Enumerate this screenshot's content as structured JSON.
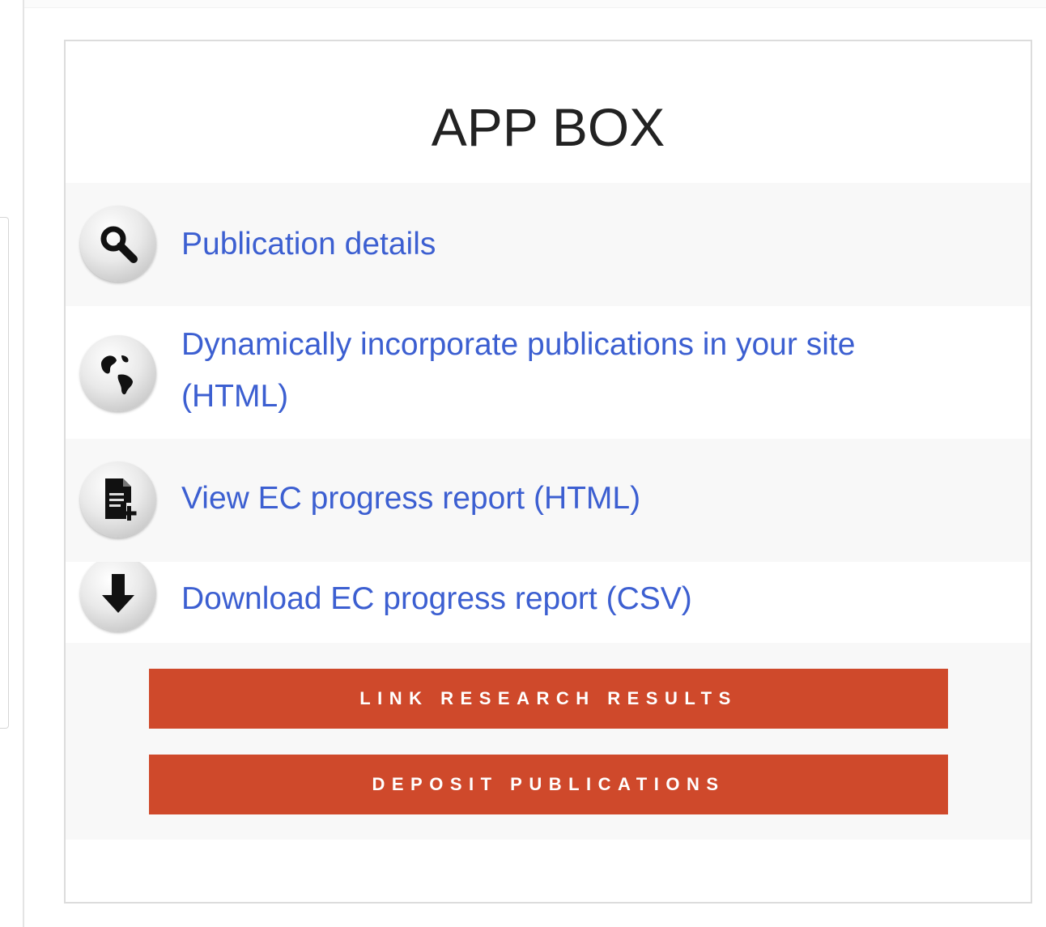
{
  "app_box": {
    "title": "APP BOX",
    "items": [
      {
        "label": "Publication details",
        "icon": "search-icon"
      },
      {
        "label": "Dynamically incorporate publications in your site",
        "label_line2": "(HTML)",
        "icon": "globe-icon"
      },
      {
        "label": "View EC progress report (HTML)",
        "icon": "document-add-icon"
      },
      {
        "label": "Download EC progress report (CSV)",
        "icon": "download-arrow-icon"
      }
    ],
    "buttons": {
      "link_research_results": "LINK RESEARCH RESULTS",
      "deposit_publications": "DEPOSIT PUBLICATIONS"
    }
  },
  "colors": {
    "link": "#3c5fd1",
    "button": "#cf492b",
    "row_shade": "#f8f8f8",
    "border": "#dcdcdc"
  }
}
